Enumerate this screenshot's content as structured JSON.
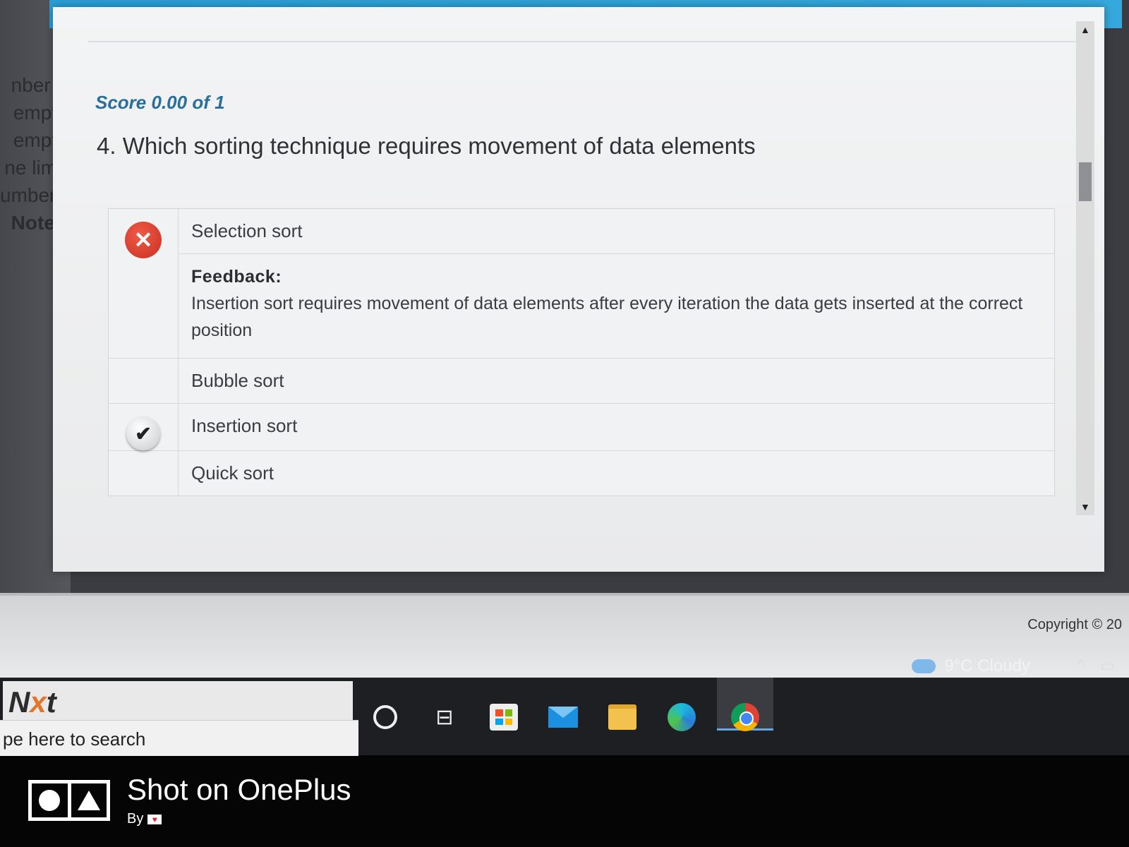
{
  "sidebar_fragments": [
    "nber o",
    "empts",
    "empts",
    "ne limit",
    "umber o",
    "Note :"
  ],
  "quiz": {
    "score": "Score 0.00 of 1",
    "question": "4. Which sorting technique requires movement of data elements",
    "options": [
      {
        "label": "Selection sort",
        "status": "incorrect"
      },
      {
        "label": "Bubble sort",
        "status": "none"
      },
      {
        "label": "Insertion sort",
        "status": "correct"
      },
      {
        "label": "Quick sort",
        "status": "none"
      }
    ],
    "feedback": {
      "title": "Feedback:",
      "text": "Insertion sort requires movement of data elements after every iteration the data gets inserted at the correct position"
    },
    "icons": {
      "incorrect": "✕",
      "correct": "✔"
    }
  },
  "footer": {
    "copyright": "Copyright © 20"
  },
  "taskbar": {
    "brand_prefix": "N",
    "brand_x": "x",
    "brand_suffix": "t",
    "search_placeholder": "pe here to search",
    "weather": "9°C  Cloudy",
    "tray_chevron": "^",
    "task_view_glyph": "⊟"
  },
  "watermark": {
    "title": "Shot on OnePlus",
    "by": "By"
  },
  "colors": {
    "accent_blue": "#2a9fd6",
    "score_color": "#2a6f9c",
    "incorrect_red": "#d9372a"
  }
}
